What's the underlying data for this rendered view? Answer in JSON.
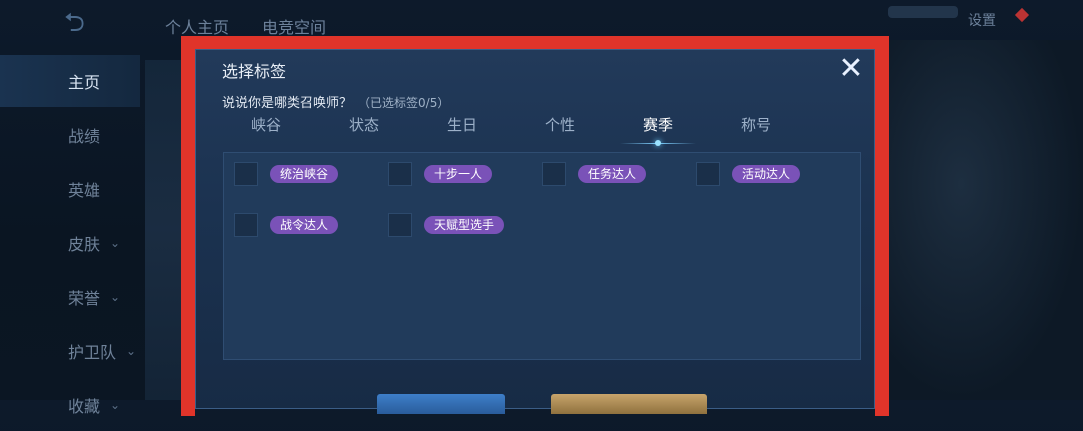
{
  "background": {
    "top_tabs": [
      "个人主页",
      "电竞空间"
    ],
    "settings_label": "设置",
    "sidebar": [
      {
        "label": "主页",
        "chevron": false,
        "active": true
      },
      {
        "label": "战绩",
        "chevron": false
      },
      {
        "label": "英雄",
        "chevron": false
      },
      {
        "label": "皮肤",
        "chevron": true
      },
      {
        "label": "荣誉",
        "chevron": true
      },
      {
        "label": "护卫队",
        "chevron": true
      },
      {
        "label": "收藏",
        "chevron": true
      }
    ]
  },
  "dialog": {
    "title": "选择标签",
    "question": "说说你是哪类召唤师？",
    "selected_count": "（已选标签0/5）",
    "tabs": [
      "峡谷",
      "状态",
      "生日",
      "个性",
      "赛季",
      "称号"
    ],
    "active_tab": "赛季",
    "tags": [
      "统治峡谷",
      "十步一人",
      "任务达人",
      "活动达人",
      "战令达人",
      "天赋型选手"
    ]
  },
  "colors": {
    "highlight_frame": "#e0342a",
    "tag_purple": "#7a52b8",
    "dialog_bg": "#1b3250"
  }
}
